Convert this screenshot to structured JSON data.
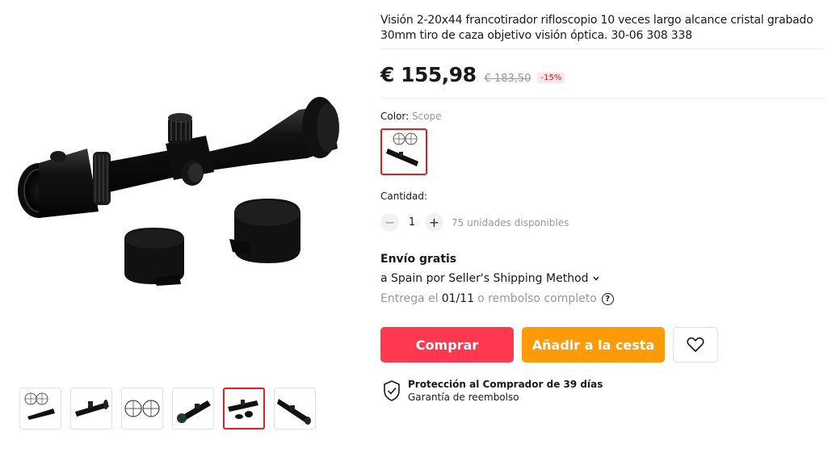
{
  "product": {
    "title": "Visión 2-20x44 francotirador rifloscopio 10 veces largo alcance cristal grabado 30mm tiro de caza objetivo visión óptica. 30-06 308 338",
    "price": "€ 155,98",
    "original_price": "€ 183,50",
    "discount": "-15%"
  },
  "gallery": {
    "thumbnails": [
      {
        "icon": "reticle-scope-thumbnail"
      },
      {
        "icon": "scope-angled-thumbnail"
      },
      {
        "icon": "reticle-pair-thumbnail"
      },
      {
        "icon": "scope-front-thumbnail"
      },
      {
        "icon": "scope-caps-thumbnail",
        "selected": true
      },
      {
        "icon": "scope-diagonal-thumbnail"
      }
    ]
  },
  "variant": {
    "label": "Color: ",
    "value": "Scope"
  },
  "quantity": {
    "label": "Cantidad:",
    "minus": "−",
    "plus": "+",
    "value": "1",
    "available": "75 unidades disponibles"
  },
  "shipping": {
    "title": "Envío gratis",
    "method": "a Spain por Seller's Shipping Method",
    "delivery_prefix": "Entrega el",
    "delivery_date": "01/11",
    "delivery_suffix": "o rembolso completo",
    "help": "?"
  },
  "actions": {
    "buy": "Comprar",
    "cart": "Añadir a la cesta"
  },
  "protection": {
    "title": "Protección al Comprador de 39 días",
    "subtitle": "Garantía de reembolso"
  },
  "colors": {
    "buy_button": "#fd384f",
    "cart_button": "#fd9a08",
    "selected_border": "#e02020",
    "discount_text": "#e02020"
  }
}
